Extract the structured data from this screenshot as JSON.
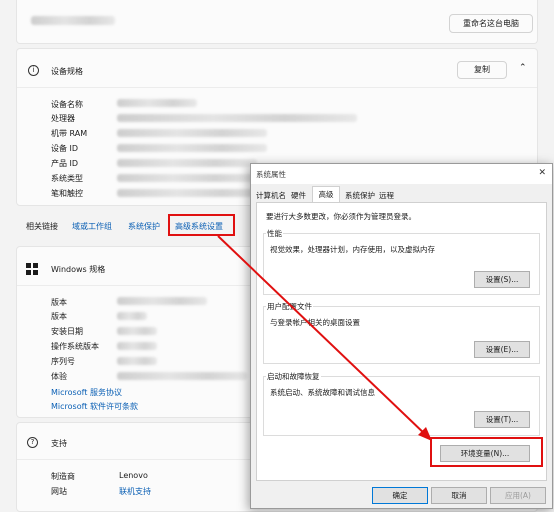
{
  "header": {
    "rename_button": "重命名这台电脑"
  },
  "device_specs": {
    "title": "设备规格",
    "copy_button": "复制",
    "rows": [
      {
        "label": "设备名称"
      },
      {
        "label": "处理器"
      },
      {
        "label": "机带 RAM"
      },
      {
        "label": "设备 ID"
      },
      {
        "label": "产品 ID"
      },
      {
        "label": "系统类型"
      },
      {
        "label": "笔和触控"
      }
    ]
  },
  "related_links": {
    "title": "相关链接",
    "links": [
      "域或工作组",
      "系统保护",
      "高级系统设置"
    ]
  },
  "windows_specs": {
    "title": "Windows 规格",
    "rows": [
      {
        "label": "版本"
      },
      {
        "label": "版本"
      },
      {
        "label": "安装日期"
      },
      {
        "label": "操作系统版本"
      },
      {
        "label": "序列号"
      },
      {
        "label": "体验"
      }
    ],
    "links": [
      "Microsoft 服务协议",
      "Microsoft 软件许可条款"
    ]
  },
  "support": {
    "title": "支持",
    "rows": [
      {
        "label": "制造商",
        "value": "Lenovo"
      },
      {
        "label": "网站",
        "value": "联机支持"
      }
    ]
  },
  "dialog": {
    "title": "系统属性",
    "close": "✕",
    "tabs": [
      "计算机名",
      "硬件",
      "高级",
      "系统保护",
      "远程"
    ],
    "active_tab": "高级",
    "admin_note": "要进行大多数更改，你必须作为管理员登录。",
    "performance": {
      "title": "性能",
      "desc": "视觉效果，处理器计划，内存使用，以及虚拟内存",
      "button": "设置(S)..."
    },
    "user_profile": {
      "title": "用户配置文件",
      "desc": "与登录帐户相关的桌面设置",
      "button": "设置(E)..."
    },
    "startup": {
      "title": "启动和故障恢复",
      "desc": "系统启动、系统故障和调试信息",
      "button": "设置(T)..."
    },
    "env_button": "环境变量(N)...",
    "ok": "确定",
    "cancel": "取消",
    "apply": "应用(A)"
  },
  "colors": {
    "highlight": "#e01010",
    "link": "#0a5fb4"
  }
}
